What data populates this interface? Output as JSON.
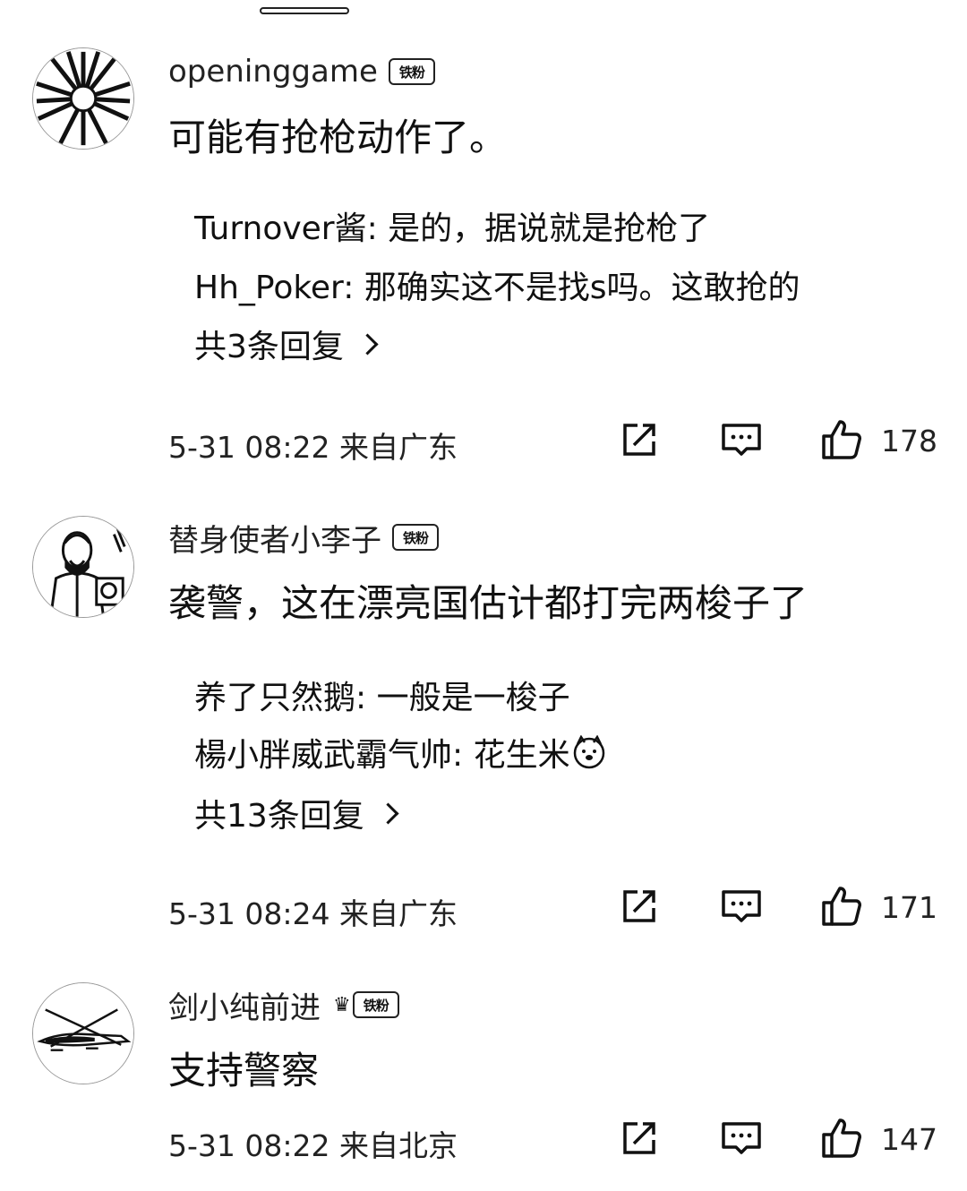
{
  "comments": [
    {
      "username": "openinggame",
      "badge": "铁粉",
      "text": "可能有抢枪动作了。",
      "replies": [
        {
          "text": "Turnover酱: 是的，据说就是抢枪了"
        },
        {
          "text": "Hh_Poker: 那确实这不是找s吗。这敢抢的"
        }
      ],
      "more_replies": "共3条回复",
      "meta": "5-31 08:22  来自广东",
      "likes": "178"
    },
    {
      "username": "替身使者小李子",
      "badge": "铁粉",
      "text": "袭警，这在漂亮国估计都打完两梭子了",
      "replies": [
        {
          "text": "养了只然鹅: 一般是一梭子"
        },
        {
          "text": "楊小胖威武霸气帅: 花生米"
        }
      ],
      "more_replies": "共13条回复",
      "meta": "5-31 08:24  来自广东",
      "likes": "171"
    },
    {
      "username": "剑小纯前进",
      "badge": "铁粉",
      "text": "支持警察",
      "replies": [],
      "more_replies": "",
      "meta": "5-31 08:22  来自北京",
      "likes": "147"
    }
  ],
  "icons": {
    "share": "share-icon",
    "comment": "comment-icon",
    "like": "thumbs-up-icon",
    "doge": "doge-emoji-icon",
    "crown": "crown-badge-icon"
  }
}
